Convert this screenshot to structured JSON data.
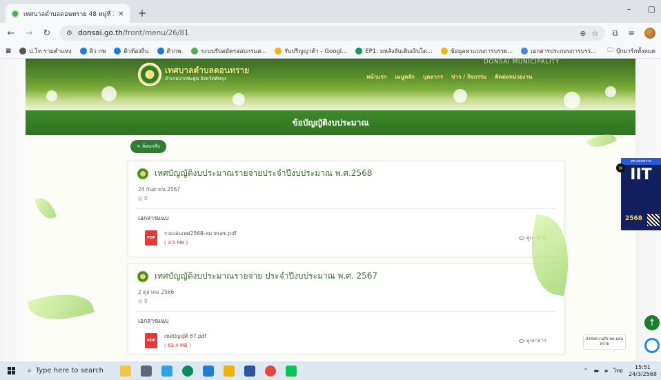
{
  "browser": {
    "tab_title": "เทศบาลตำบลดอนทราย 48 หมู่ที่ 3 ต",
    "tab_close": "×",
    "new_tab": "+",
    "url_domain": "donsai.go.th",
    "url_path": "/front/menu/26/81",
    "window_minimize": "–",
    "window_maximize": "▢",
    "bookmarks": [
      {
        "label": "ป.โท รามคำแหง",
        "color": "#555555"
      },
      {
        "label": "ติว กพ",
        "color": "#1877f2"
      },
      {
        "label": "ติวท้องถิ่น",
        "color": "#1877f2"
      },
      {
        "label": "ติวกพ.",
        "color": "#1877f2"
      },
      {
        "label": "ระบบรับสมัครสอบกรมส...",
        "color": "#4caf50"
      },
      {
        "label": "รับปริญญาด้า - Googl...",
        "color": "#f4b400"
      },
      {
        "label": "EP1: มหลังจับเติมเงินโด...",
        "color": "#0f9d58"
      },
      {
        "label": "ข้อมูลหาแบบการบรรย...",
        "color": "#f4b400"
      },
      {
        "label": "เอกสารประกอบการบรร...",
        "color": "#4285f4"
      }
    ],
    "bookmarks_folder": "บุ๊กมาร์กทั้งหมด"
  },
  "site": {
    "logo_title": "เทศบาลตำบลดอนทราย",
    "logo_subtitle": "อำเภอปากพะยูน จังหวัดพัทลุง",
    "english_name": "DONSAI MUNICIPALITY",
    "nav": [
      "หน้าแรก",
      "เมนูหลัก",
      "บุคลากร",
      "ข่าว / กิจกรรม",
      "ติดต่อหน่วยงาน"
    ],
    "page_title": "ข้อบัญญัติงบประมาณ",
    "back_label": "< ย้อนกลับ"
  },
  "posts": [
    {
      "title": "เทศบัญญัติงบประมาณรายจ่ายประจำปีงบประมาณ พ.ศ.2568",
      "date": "24 กันยายน 2567",
      "views": "0",
      "attachments_label": "เอกสารแนบ",
      "file_name": "รวมเล่มเทศ2568-หมายเลข.pdf",
      "file_size": "( 3.5 MB )",
      "view_label": "ดูเอกสาร",
      "file_type": "PDF"
    },
    {
      "title": "เทศบัญญัติงบประมาณรายจ่าย ประจำปีงบประมาณ พ.ศ. 2567",
      "date": "2 ตุลาคม 2566",
      "views": "0",
      "attachments_label": "เอกสารแนบ",
      "file_name": "เทศบัญญัติ 67.pdf",
      "file_size": "( 63.4 MB )",
      "view_label": "ดูเอกสาร",
      "file_type": "PDF"
    }
  ],
  "widgets": {
    "iit_header": "ทต.ดอนทราย",
    "iit_text": "IIT",
    "iit_year": "2568",
    "iit_close": "×",
    "scroll_top": "↑",
    "chat_text": "ส่งข้อความถึง ทต.ดอนทราย"
  },
  "taskbar": {
    "search_placeholder": "Type here to search",
    "language": "ไทย",
    "time": "15:51",
    "date": "24/3/2568"
  }
}
